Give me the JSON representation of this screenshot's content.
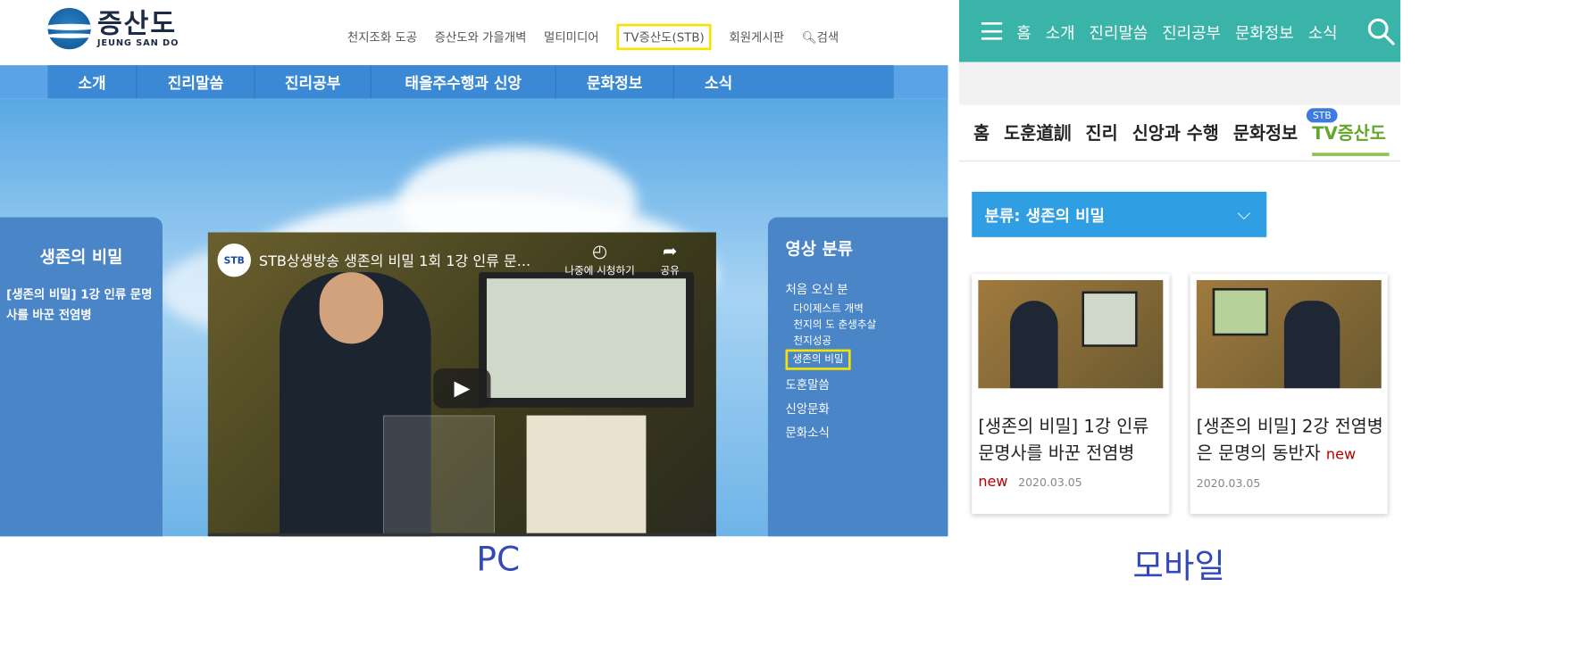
{
  "pc": {
    "logo_ko": "증산도",
    "logo_en": "JEUNG SAN DO",
    "topnav": [
      "천지조화 도공",
      "증산도와 가을개벽",
      "멀티미디어",
      "TV증산도(STB)",
      "회원게시판",
      "검색"
    ],
    "mainnav": [
      "소개",
      "진리말씀",
      "진리공부",
      "태을주수행과 신앙",
      "문화정보",
      "소식"
    ],
    "left_title": "생존의 비밀",
    "left_link": "[생존의 비밀] 1강 인류 문명사를 바꾼 전염병",
    "video": {
      "channel_logo": "STB",
      "title": "STB상생방송 생존의 비밀 1회 1강 인류 문...",
      "watch_later": "나중에 시청하기",
      "share": "공유"
    },
    "right_title": "영상 분류",
    "categories": {
      "first_visit": "처음 오신 분",
      "subs": [
        "다이제스트 개벽",
        "천지의 도 춘생추살",
        "천지성공"
      ],
      "selected": "생존의 비밀",
      "others": [
        "도훈말씀",
        "신앙문화",
        "문화소식"
      ]
    }
  },
  "mobile": {
    "topnav": [
      "홈",
      "소개",
      "진리말씀",
      "진리공부",
      "문화정보",
      "소식"
    ],
    "tabs": [
      "홈",
      "도훈道訓",
      "진리",
      "신앙과 수행",
      "문화정보",
      "TV증산도"
    ],
    "stb_badge": "STB",
    "filter": "분류: 생존의 비밀",
    "cards": [
      {
        "title": "[생존의 비밀] 1강 인류 문명사를 바꾼 전염병",
        "new": "new",
        "date": "2020.03.05"
      },
      {
        "title": "[생존의 비밀] 2강 전염병은 문명의 동반자",
        "new": "new",
        "date": "2020.03.05"
      }
    ]
  },
  "captions": {
    "pc": "PC",
    "mobile": "모바일"
  },
  "colors": {
    "highlight": "#f4e200",
    "mobile_header": "#3ab3a9",
    "pc_nav": "#3b89d5",
    "active_tab": "#61a82a",
    "new": "#b50000"
  }
}
